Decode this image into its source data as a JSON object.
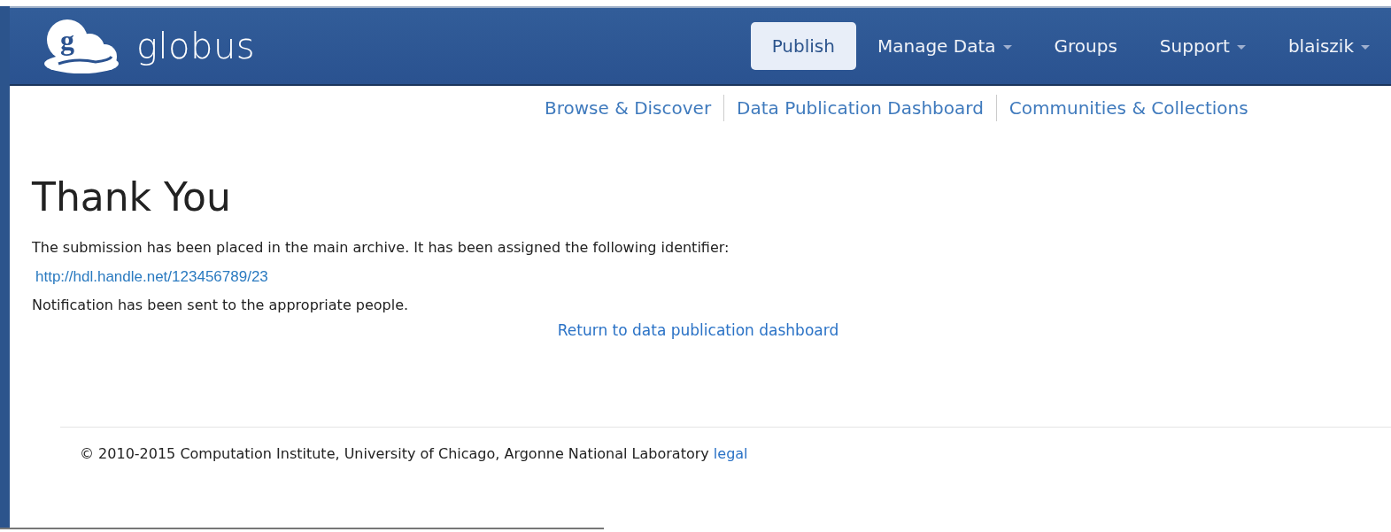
{
  "brand": {
    "name": "globus",
    "logo_letter": "g"
  },
  "nav": [
    {
      "label": "Publish",
      "selected": true,
      "dropdown": false
    },
    {
      "label": "Manage Data",
      "selected": false,
      "dropdown": true
    },
    {
      "label": "Groups",
      "selected": false,
      "dropdown": false
    },
    {
      "label": "Support",
      "selected": false,
      "dropdown": true
    },
    {
      "label": "blaiszik",
      "selected": false,
      "dropdown": true
    }
  ],
  "subnav": [
    "Browse & Discover",
    "Data Publication Dashboard",
    "Communities & Collections"
  ],
  "heading": "Thank You",
  "message": "The submission has been placed in the main archive. It has been assigned the following identifier:",
  "identifier_link": "http://hdl.handle.net/123456789/23",
  "notification": "Notification has been sent to the appropriate people.",
  "return_link": "Return to data publication dashboard",
  "footer": {
    "text": "© 2010-2015 Computation Institute, University of Chicago, Argonne National Laboratory",
    "link": "legal"
  }
}
